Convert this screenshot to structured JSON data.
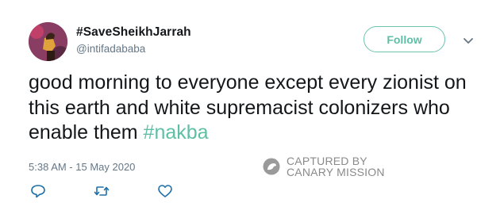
{
  "user": {
    "display_name": "#SaveSheikhJarrah",
    "handle": "@intifadababa"
  },
  "follow_button": {
    "label": "Follow"
  },
  "tweet": {
    "text_main": "good morning to everyone except every zionist on this earth and white supremacist colonizers who enable them ",
    "hashtag": "#nakba",
    "timestamp": "5:38 AM - 15 May 2020"
  },
  "watermark": {
    "line1": "CAPTURED BY",
    "line2": "CANARY MISSION"
  },
  "icons": {
    "reply": "reply-icon",
    "retweet": "retweet-icon",
    "like": "heart-icon",
    "more": "chevron-down-icon"
  },
  "colors": {
    "accent": "#5fbfa6",
    "text": "#14171a",
    "secondary": "#657786"
  }
}
